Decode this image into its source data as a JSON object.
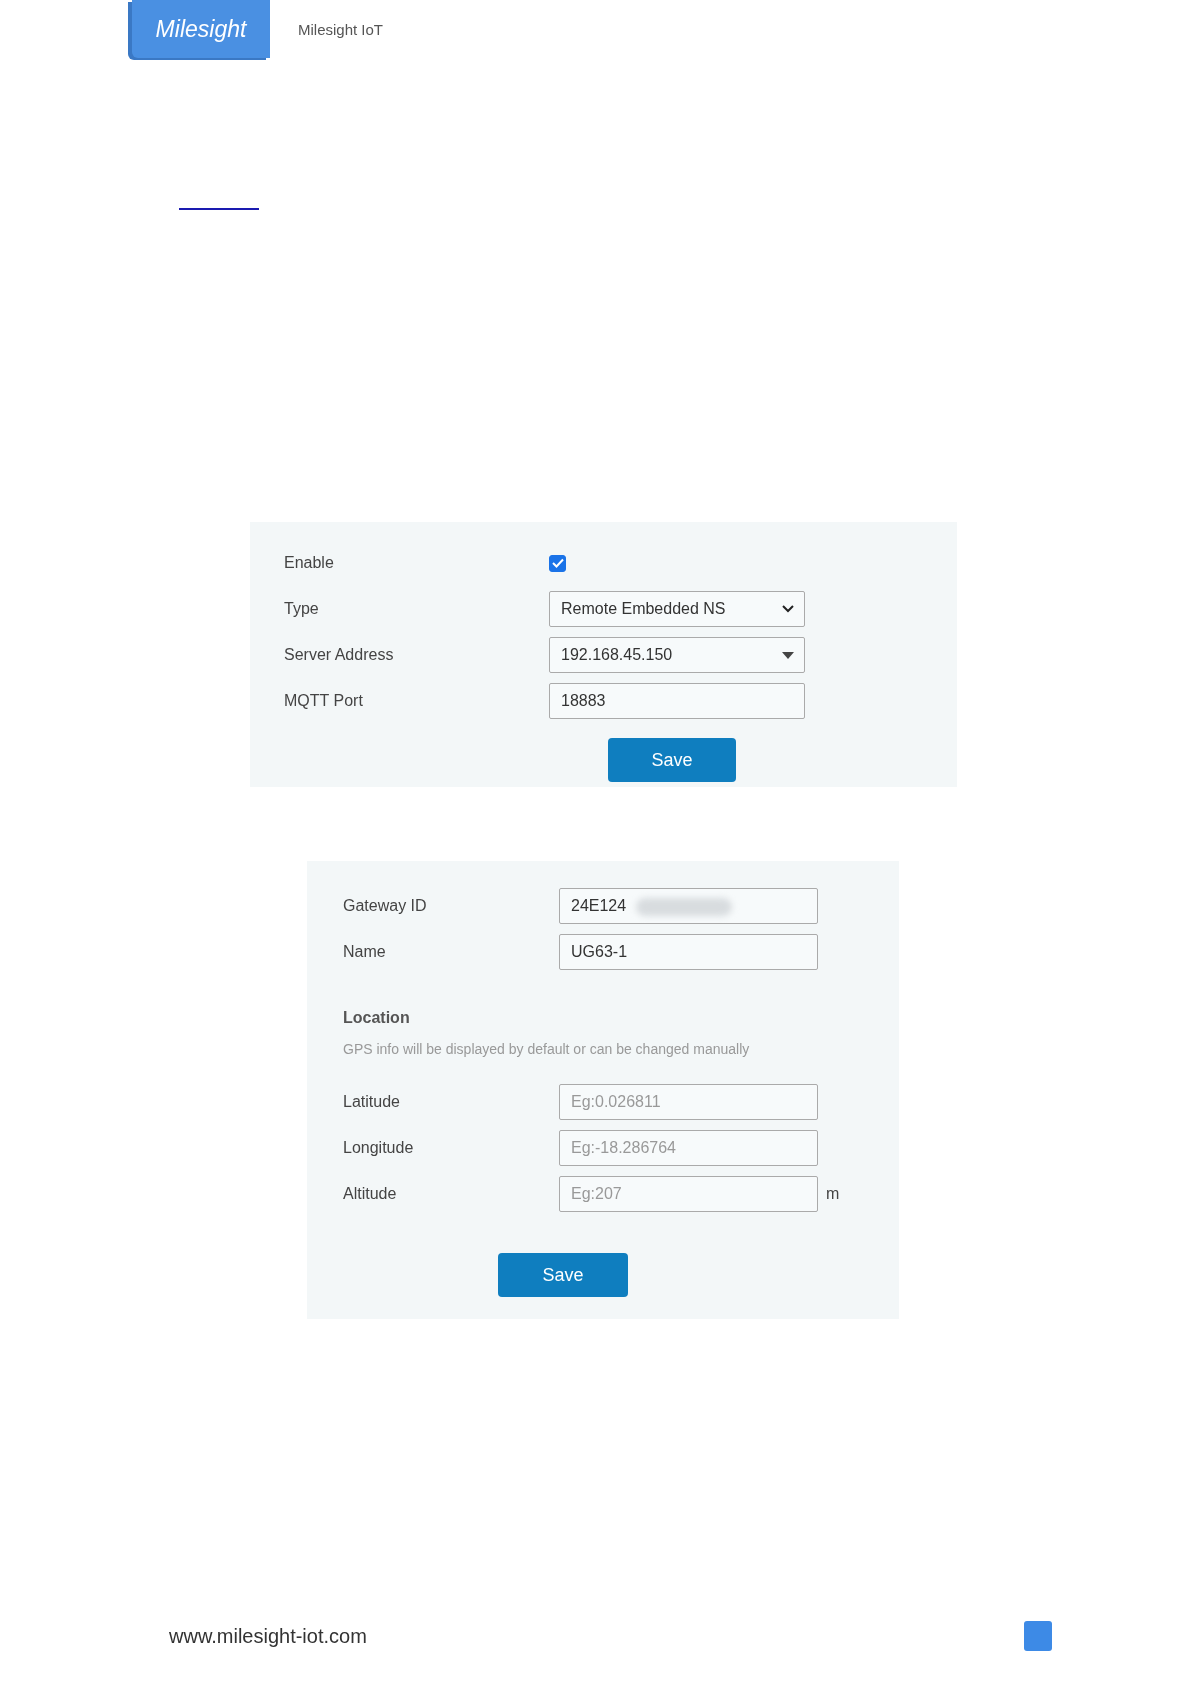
{
  "header": {
    "logo": "Milesight",
    "title": "Milesight IoT"
  },
  "form_1": {
    "rows": [
      {
        "kind": "checkbox",
        "label": "Enable",
        "checked": true
      },
      {
        "kind": "select",
        "label": "Type",
        "value": "Remote Embedded NS"
      },
      {
        "kind": "combo",
        "label": "Server Address",
        "value": "192.168.45.150"
      },
      {
        "kind": "text",
        "label": "MQTT Port",
        "value": "18883"
      }
    ],
    "button": "Save"
  },
  "form_2": {
    "rows": [
      {
        "label": "Gateway ID",
        "value": "24E124",
        "redacted": true
      },
      {
        "label": "Name",
        "value": "UG63-1"
      }
    ],
    "section_title": "Location",
    "section_hint": "GPS info will be displayed by default or can be changed manually",
    "location_rows": [
      {
        "label": "Latitude",
        "placeholder": "Eg:0.026811"
      },
      {
        "label": "Longitude",
        "placeholder": "Eg:-18.286764"
      },
      {
        "label": "Altitude",
        "placeholder": "Eg:207",
        "unit": "m"
      }
    ],
    "button": "Save"
  },
  "footer": {
    "url": "www.milesight-iot.com"
  }
}
